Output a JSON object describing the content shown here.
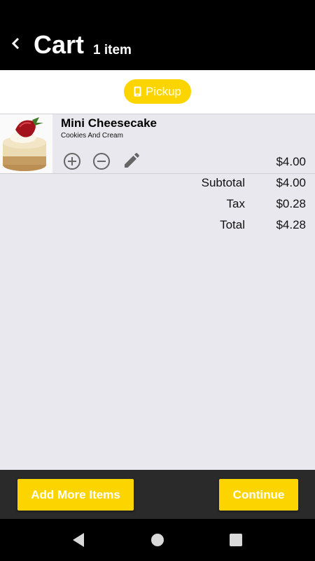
{
  "header": {
    "back_icon": "chevron-left-icon",
    "title": "Cart",
    "item_count": "1 item"
  },
  "order_mode": {
    "label": "Pickup",
    "icon": "phone-icon"
  },
  "cart_items": [
    {
      "name": "Mini Cheesecake",
      "variant": "Cookies And Cream",
      "price": "$4.00",
      "image": "cheesecake-photo",
      "actions": [
        "add-circle-icon",
        "remove-circle-icon",
        "pencil-icon"
      ]
    }
  ],
  "summary": {
    "subtotal_label": "Subtotal",
    "subtotal_value": "$4.00",
    "tax_label": "Tax",
    "tax_value": "$0.28",
    "total_label": "Total",
    "total_value": "$4.28"
  },
  "footer": {
    "add_more_label": "Add More Items",
    "continue_label": "Continue"
  },
  "system_nav": {
    "back": "triangle-back-icon",
    "home": "circle-home-icon",
    "recents": "square-recents-icon"
  },
  "colors": {
    "accent": "#fcd500",
    "header_bg": "#000000",
    "page_bg": "#e9e8ee",
    "footer_bg": "#2a2a2a"
  }
}
